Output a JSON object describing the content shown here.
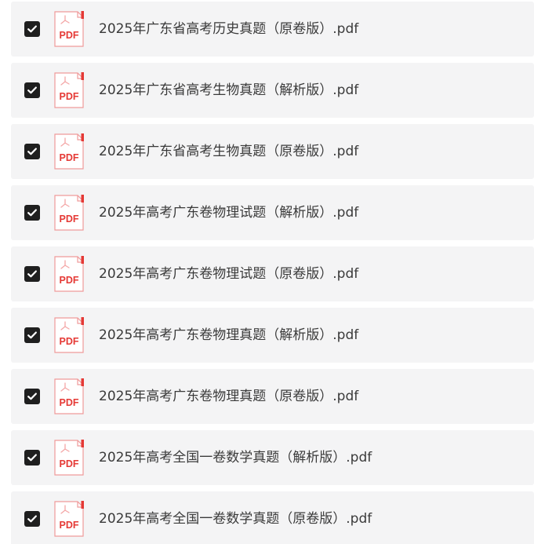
{
  "files": [
    {
      "name": "2025年广东省高考历史真题（原卷版）.pdf",
      "checked": true,
      "icon": "pdf-icon",
      "badge": "PDF"
    },
    {
      "name": "2025年广东省高考生物真题（解析版）.pdf",
      "checked": true,
      "icon": "pdf-icon",
      "badge": "PDF"
    },
    {
      "name": "2025年广东省高考生物真题（原卷版）.pdf",
      "checked": true,
      "icon": "pdf-icon",
      "badge": "PDF"
    },
    {
      "name": "2025年高考广东卷物理试题（解析版）.pdf",
      "checked": true,
      "icon": "pdf-icon",
      "badge": "PDF"
    },
    {
      "name": "2025年高考广东卷物理试题（原卷版）.pdf",
      "checked": true,
      "icon": "pdf-icon",
      "badge": "PDF"
    },
    {
      "name": "2025年高考广东卷物理真题（解析版）.pdf",
      "checked": true,
      "icon": "pdf-icon",
      "badge": "PDF"
    },
    {
      "name": "2025年高考广东卷物理真题（原卷版）.pdf",
      "checked": true,
      "icon": "pdf-icon",
      "badge": "PDF"
    },
    {
      "name": "2025年高考全国一卷数学真题（解析版）.pdf",
      "checked": true,
      "icon": "pdf-icon",
      "badge": "PDF"
    },
    {
      "name": "2025年高考全国一卷数学真题（原卷版）.pdf",
      "checked": true,
      "icon": "pdf-icon",
      "badge": "PDF"
    }
  ],
  "colors": {
    "row_background": "#f4f4f5",
    "checkbox_fill": "#1f1f1f",
    "pdf_red": "#e53935",
    "text": "#3a3a3a"
  }
}
